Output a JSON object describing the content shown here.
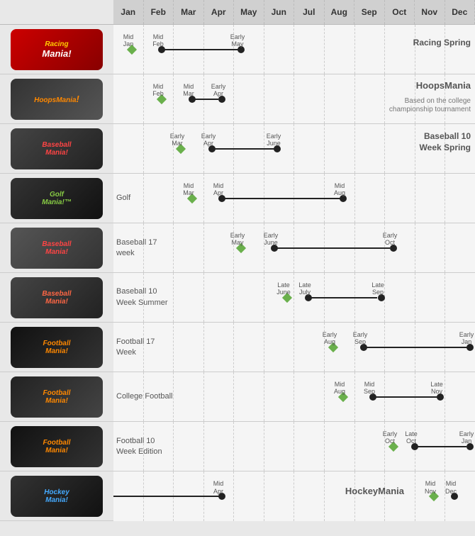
{
  "header": {
    "months": [
      "Jan",
      "Feb",
      "Mar",
      "Apr",
      "May",
      "Jun",
      "Jul",
      "Aug",
      "Sep",
      "Oct",
      "Nov",
      "Dec"
    ]
  },
  "sidebar": {
    "items": [
      {
        "label": "Racing Mania",
        "class": "logo-racing"
      },
      {
        "label": "HoopsMania",
        "class": "logo-hoops"
      },
      {
        "label": "Baseball Mania",
        "class": "logo-baseball1"
      },
      {
        "label": "Golf Mania",
        "class": "logo-golf"
      },
      {
        "label": "Baseball Mania",
        "class": "logo-baseball2"
      },
      {
        "label": "Baseball Mania",
        "class": "logo-baseball3"
      },
      {
        "label": "Football Mania",
        "class": "logo-football1"
      },
      {
        "label": "Football Mania",
        "class": "logo-football2"
      },
      {
        "label": "Football Mania",
        "class": "logo-football3"
      },
      {
        "label": "Hockey Mania",
        "class": "logo-hockey"
      }
    ]
  },
  "rows": [
    {
      "id": "racing",
      "title": "Racing Spring",
      "subtitle": "",
      "label": ""
    },
    {
      "id": "hoops",
      "title": "HoopsMania",
      "subtitle": "Based on the college\nchampionship tournament",
      "label": ""
    },
    {
      "id": "baseball10spring",
      "title": "Baseball 10\nWeek Spring",
      "subtitle": "",
      "label": ""
    },
    {
      "id": "golf",
      "title": "",
      "subtitle": "",
      "label": "Golf"
    },
    {
      "id": "baseball17",
      "title": "",
      "subtitle": "",
      "label": "Baseball 17 week"
    },
    {
      "id": "baseball10summer",
      "title": "",
      "subtitle": "",
      "label": "Baseball 10\nWeek Summer"
    },
    {
      "id": "football17",
      "title": "",
      "subtitle": "",
      "label": "Football 17 Week"
    },
    {
      "id": "collegefootball",
      "title": "",
      "subtitle": "",
      "label": "College Football"
    },
    {
      "id": "football10",
      "title": "",
      "subtitle": "",
      "label": "Football 10 Week Edition"
    },
    {
      "id": "hockey",
      "title": "HockeyMania",
      "subtitle": "",
      "label": ""
    }
  ]
}
